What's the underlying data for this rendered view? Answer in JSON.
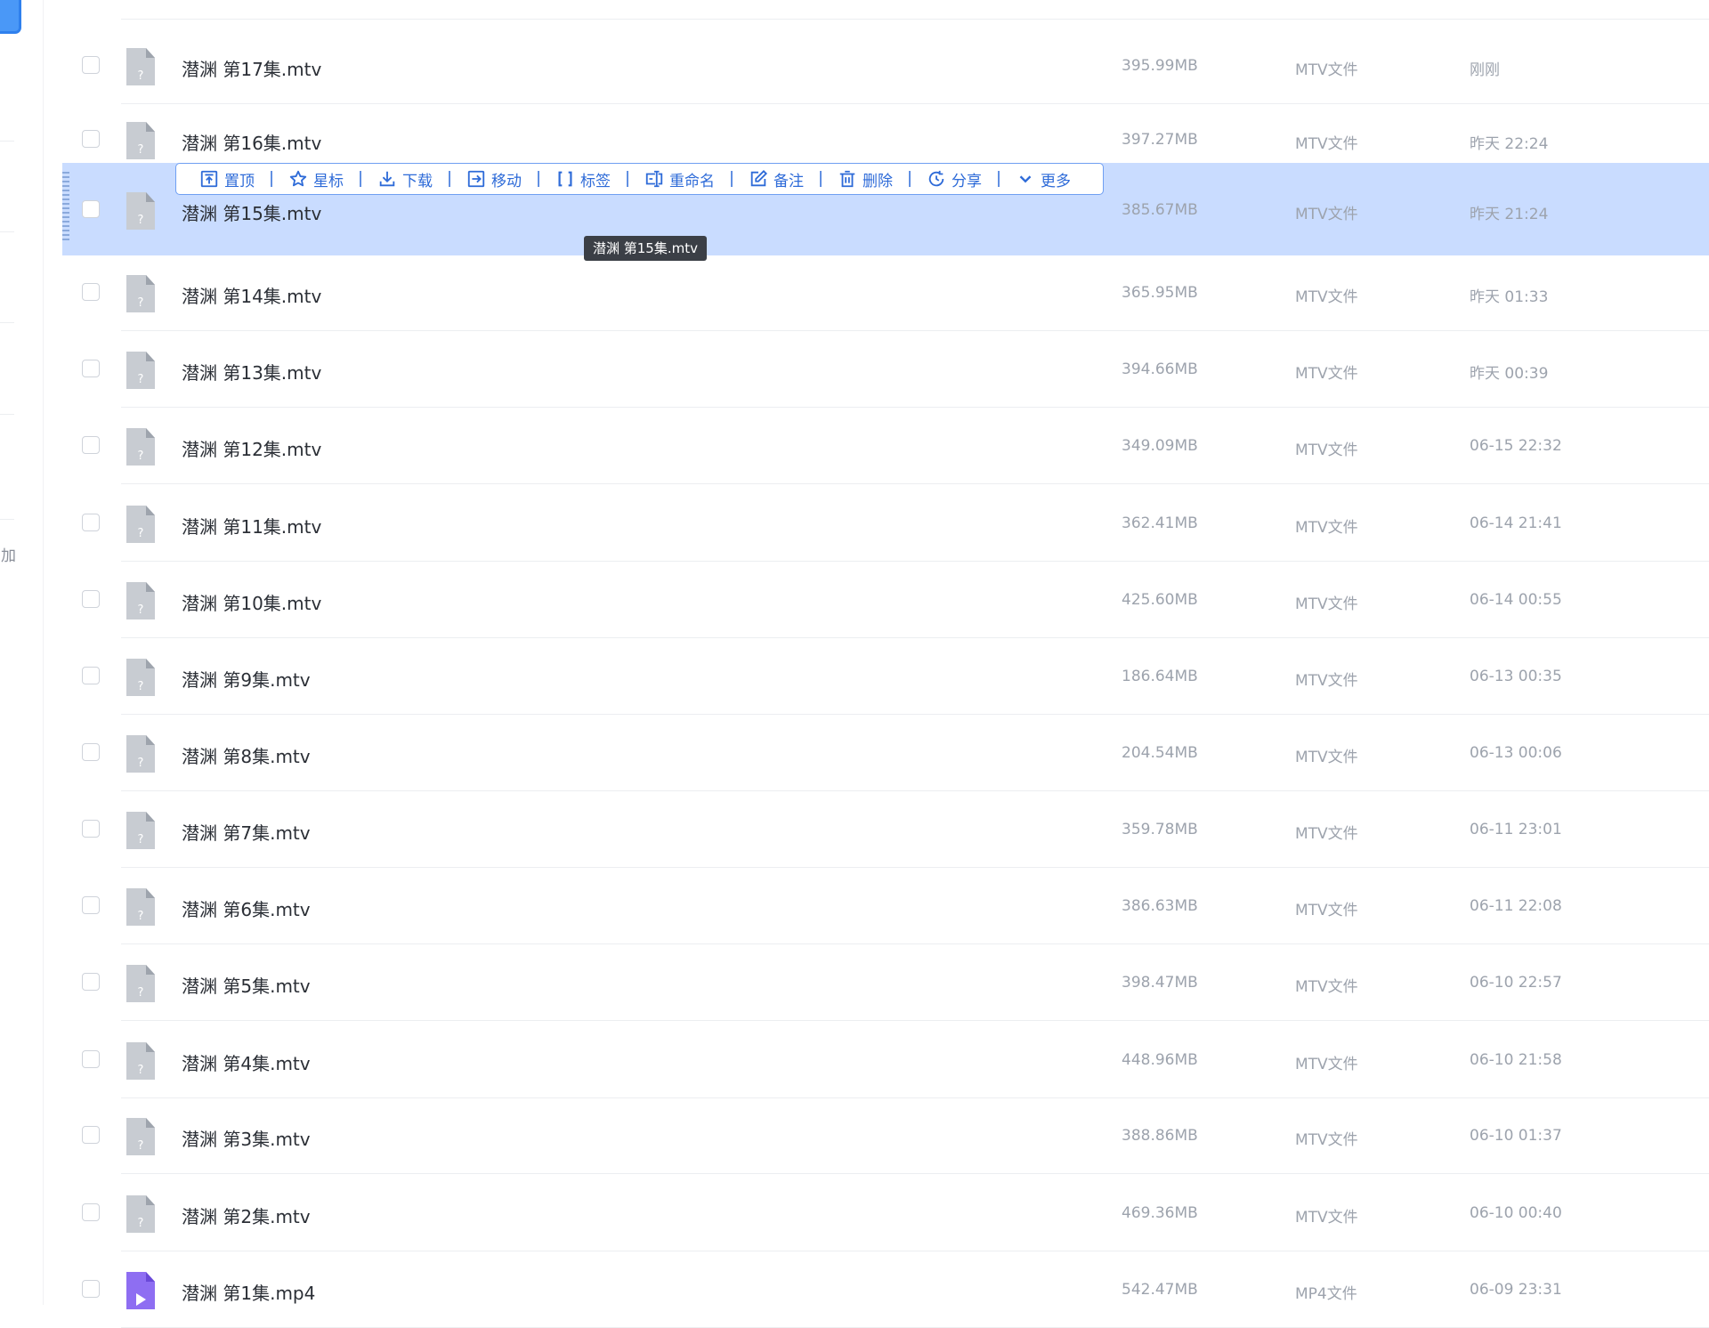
{
  "sidebar": {
    "partial_label": "加"
  },
  "toolbar": [
    {
      "id": "pin",
      "label": "置顶",
      "icon": "pin-top-icon"
    },
    {
      "id": "star",
      "label": "星标",
      "icon": "star-icon"
    },
    {
      "id": "download",
      "label": "下载",
      "icon": "download-icon"
    },
    {
      "id": "move",
      "label": "移动",
      "icon": "move-icon"
    },
    {
      "id": "tag",
      "label": "标签",
      "icon": "tag-icon"
    },
    {
      "id": "rename",
      "label": "重命名",
      "icon": "rename-icon"
    },
    {
      "id": "note",
      "label": "备注",
      "icon": "note-icon"
    },
    {
      "id": "delete",
      "label": "删除",
      "icon": "trash-icon"
    },
    {
      "id": "share",
      "label": "分享",
      "icon": "share-icon"
    },
    {
      "id": "more",
      "label": "更多",
      "icon": "chevron-down-icon"
    }
  ],
  "tooltip": {
    "text": "潜渊 第15集.mtv"
  },
  "files": [
    {
      "name": "潜渊 第17集.mtv",
      "size": "395.99MB",
      "type": "MTV文件",
      "time": "刚刚",
      "kind": "unknown"
    },
    {
      "name": "潜渊 第16集.mtv",
      "size": "397.27MB",
      "type": "MTV文件",
      "time": "昨天 22:24",
      "kind": "unknown"
    },
    {
      "name": "潜渊 第15集.mtv",
      "size": "385.67MB",
      "type": "MTV文件",
      "time": "昨天 21:24",
      "kind": "unknown",
      "active": true
    },
    {
      "name": "潜渊 第14集.mtv",
      "size": "365.95MB",
      "type": "MTV文件",
      "time": "昨天 01:33",
      "kind": "unknown"
    },
    {
      "name": "潜渊 第13集.mtv",
      "size": "394.66MB",
      "type": "MTV文件",
      "time": "昨天 00:39",
      "kind": "unknown"
    },
    {
      "name": "潜渊 第12集.mtv",
      "size": "349.09MB",
      "type": "MTV文件",
      "time": "06-15 22:32",
      "kind": "unknown"
    },
    {
      "name": "潜渊 第11集.mtv",
      "size": "362.41MB",
      "type": "MTV文件",
      "time": "06-14 21:41",
      "kind": "unknown"
    },
    {
      "name": "潜渊 第10集.mtv",
      "size": "425.60MB",
      "type": "MTV文件",
      "time": "06-14 00:55",
      "kind": "unknown"
    },
    {
      "name": "潜渊 第9集.mtv",
      "size": "186.64MB",
      "type": "MTV文件",
      "time": "06-13 00:35",
      "kind": "unknown"
    },
    {
      "name": "潜渊 第8集.mtv",
      "size": "204.54MB",
      "type": "MTV文件",
      "time": "06-13 00:06",
      "kind": "unknown"
    },
    {
      "name": "潜渊 第7集.mtv",
      "size": "359.78MB",
      "type": "MTV文件",
      "time": "06-11 23:01",
      "kind": "unknown"
    },
    {
      "name": "潜渊 第6集.mtv",
      "size": "386.63MB",
      "type": "MTV文件",
      "time": "06-11 22:08",
      "kind": "unknown"
    },
    {
      "name": "潜渊 第5集.mtv",
      "size": "398.47MB",
      "type": "MTV文件",
      "time": "06-10 22:57",
      "kind": "unknown"
    },
    {
      "name": "潜渊 第4集.mtv",
      "size": "448.96MB",
      "type": "MTV文件",
      "time": "06-10 21:58",
      "kind": "unknown"
    },
    {
      "name": "潜渊 第3集.mtv",
      "size": "388.86MB",
      "type": "MTV文件",
      "time": "06-10 01:37",
      "kind": "unknown"
    },
    {
      "name": "潜渊 第2集.mtv",
      "size": "469.36MB",
      "type": "MTV文件",
      "time": "06-10 00:40",
      "kind": "unknown"
    },
    {
      "name": "潜渊 第1集.mp4",
      "size": "542.47MB",
      "type": "MP4文件",
      "time": "06-09 23:31",
      "kind": "video"
    }
  ]
}
